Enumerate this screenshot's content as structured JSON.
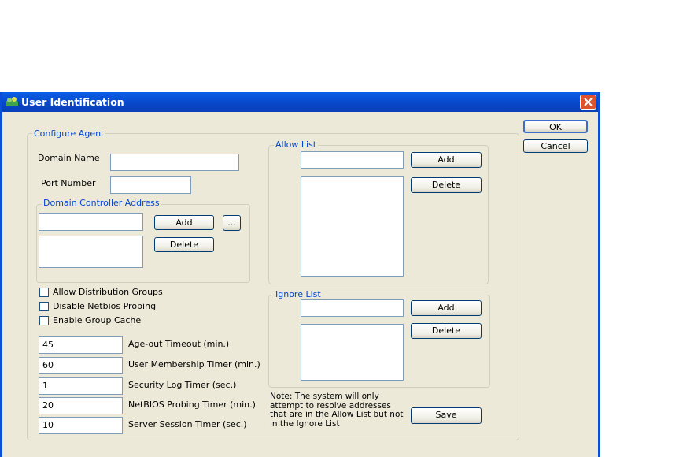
{
  "window": {
    "title": "User Identification"
  },
  "buttons": {
    "ok": "OK",
    "cancel": "Cancel"
  },
  "configure_agent": {
    "legend": "Configure Agent",
    "domain_name_label": "Domain Name",
    "domain_name_value": "",
    "port_number_label": "Port Number",
    "port_number_value": "",
    "dc_address": {
      "legend": "Domain Controller Address",
      "add": "Add",
      "browse": "...",
      "delete": "Delete"
    },
    "checkboxes": [
      {
        "label": "Allow Distribution Groups",
        "checked": false
      },
      {
        "label": "Disable Netbios Probing",
        "checked": false
      },
      {
        "label": "Enable Group Cache",
        "checked": false
      }
    ],
    "timers": [
      {
        "value": "45",
        "label": "Age-out Timeout (min.)"
      },
      {
        "value": "60",
        "label": "User Membership Timer (min.)"
      },
      {
        "value": "1",
        "label": "Security Log Timer (sec.)"
      },
      {
        "value": "20",
        "label": "NetBIOS Probing Timer (min.)"
      },
      {
        "value": "10",
        "label": "Server Session Timer (sec.)"
      }
    ]
  },
  "allow_list": {
    "legend": "Allow List",
    "add": "Add",
    "delete": "Delete"
  },
  "ignore_list": {
    "legend": "Ignore List",
    "add": "Add",
    "delete": "Delete"
  },
  "note": "Note: The system will only attempt to resolve addresses that are in the Allow List but not in the Ignore List",
  "save": "Save"
}
